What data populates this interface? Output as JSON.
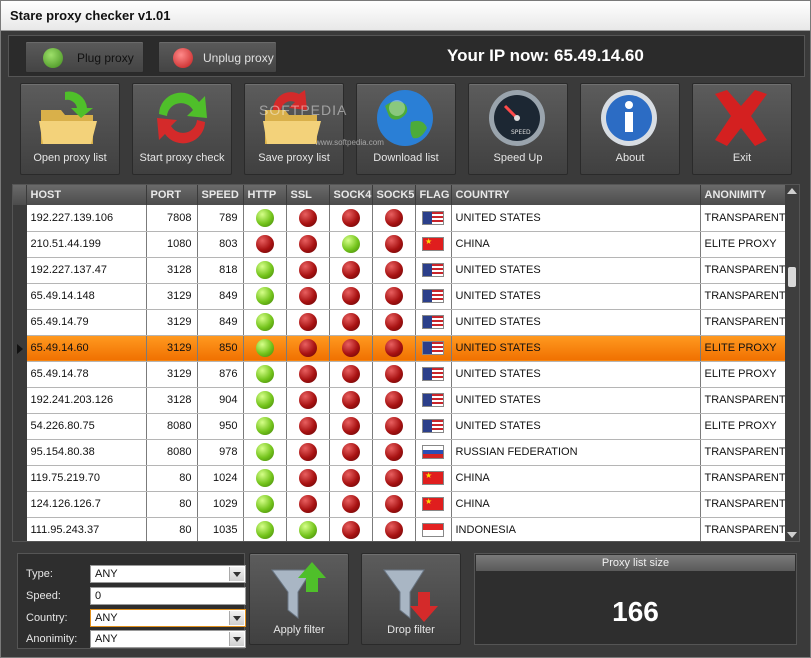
{
  "window": {
    "title": "Stare proxy checker v1.01"
  },
  "topbar": {
    "plug_label": "Plug proxy",
    "unplug_label": "Unplug proxy",
    "ip_text": "Your IP now: 65.49.14.60"
  },
  "toolbar": [
    {
      "label": "Open proxy list",
      "icon": "folder-open-icon"
    },
    {
      "label": "Start proxy check",
      "icon": "refresh-arrows-icon"
    },
    {
      "label": "Save proxy list",
      "icon": "folder-save-icon"
    },
    {
      "label": "Download list",
      "icon": "globe-icon"
    },
    {
      "label": "Speed Up",
      "icon": "speedometer-icon"
    },
    {
      "label": "About",
      "icon": "info-icon"
    },
    {
      "label": "Exit",
      "icon": "close-x-icon"
    }
  ],
  "watermark": {
    "main": "SOFTPEDIA",
    "sub": "www.softpedia.com"
  },
  "grid": {
    "columns": [
      "HOST",
      "PORT",
      "SPEED",
      "HTTP",
      "SSL",
      "SOCK4",
      "SOCK5",
      "FLAG",
      "COUNTRY",
      "ANONIMITY"
    ],
    "selected_row": 5,
    "rows": [
      {
        "host": "192.227.139.106",
        "port": "7808",
        "speed": "789",
        "http": "g",
        "ssl": "r",
        "sock4": "r",
        "sock5": "r",
        "flag": "us",
        "country": "UNITED STATES",
        "anonimity": "TRANSPARENT"
      },
      {
        "host": "210.51.44.199",
        "port": "1080",
        "speed": "803",
        "http": "r",
        "ssl": "r",
        "sock4": "g",
        "sock5": "r",
        "flag": "cn",
        "country": "CHINA",
        "anonimity": "ELITE PROXY"
      },
      {
        "host": "192.227.137.47",
        "port": "3128",
        "speed": "818",
        "http": "g",
        "ssl": "r",
        "sock4": "r",
        "sock5": "r",
        "flag": "us",
        "country": "UNITED STATES",
        "anonimity": "TRANSPARENT"
      },
      {
        "host": "65.49.14.148",
        "port": "3129",
        "speed": "849",
        "http": "g",
        "ssl": "r",
        "sock4": "r",
        "sock5": "r",
        "flag": "us",
        "country": "UNITED STATES",
        "anonimity": "TRANSPARENT"
      },
      {
        "host": "65.49.14.79",
        "port": "3129",
        "speed": "849",
        "http": "g",
        "ssl": "r",
        "sock4": "r",
        "sock5": "r",
        "flag": "us",
        "country": "UNITED STATES",
        "anonimity": "TRANSPARENT"
      },
      {
        "host": "65.49.14.60",
        "port": "3129",
        "speed": "850",
        "http": "g",
        "ssl": "r",
        "sock4": "r",
        "sock5": "r",
        "flag": "us",
        "country": "UNITED STATES",
        "anonimity": "ELITE PROXY"
      },
      {
        "host": "65.49.14.78",
        "port": "3129",
        "speed": "876",
        "http": "g",
        "ssl": "r",
        "sock4": "r",
        "sock5": "r",
        "flag": "us",
        "country": "UNITED STATES",
        "anonimity": "ELITE PROXY"
      },
      {
        "host": "192.241.203.126",
        "port": "3128",
        "speed": "904",
        "http": "g",
        "ssl": "r",
        "sock4": "r",
        "sock5": "r",
        "flag": "us",
        "country": "UNITED STATES",
        "anonimity": "TRANSPARENT"
      },
      {
        "host": "54.226.80.75",
        "port": "8080",
        "speed": "950",
        "http": "g",
        "ssl": "r",
        "sock4": "r",
        "sock5": "r",
        "flag": "us",
        "country": "UNITED STATES",
        "anonimity": "ELITE PROXY"
      },
      {
        "host": "95.154.80.38",
        "port": "8080",
        "speed": "978",
        "http": "g",
        "ssl": "r",
        "sock4": "r",
        "sock5": "r",
        "flag": "ru",
        "country": "RUSSIAN FEDERATION",
        "anonimity": "TRANSPARENT"
      },
      {
        "host": "119.75.219.70",
        "port": "80",
        "speed": "1024",
        "http": "g",
        "ssl": "r",
        "sock4": "r",
        "sock5": "r",
        "flag": "cn",
        "country": "CHINA",
        "anonimity": "TRANSPARENT"
      },
      {
        "host": "124.126.126.7",
        "port": "80",
        "speed": "1029",
        "http": "g",
        "ssl": "r",
        "sock4": "r",
        "sock5": "r",
        "flag": "cn",
        "country": "CHINA",
        "anonimity": "TRANSPARENT"
      },
      {
        "host": "111.95.243.37",
        "port": "80",
        "speed": "1035",
        "http": "g",
        "ssl": "g",
        "sock4": "r",
        "sock5": "r",
        "flag": "id",
        "country": "INDONESIA",
        "anonimity": "TRANSPARENT"
      }
    ]
  },
  "filters": {
    "type_label": "Type:",
    "type_value": "ANY",
    "speed_label": "Speed:",
    "speed_value": "0",
    "country_label": "Country:",
    "country_value": "ANY",
    "anonimity_label": "Anonimity:",
    "anonimity_value": "ANY",
    "apply_label": "Apply filter",
    "drop_label": "Drop filter"
  },
  "proxy_size": {
    "header": "Proxy list size",
    "value": "166"
  },
  "colors": {
    "selected_row": "#f58a10",
    "status_green": "#74c41c",
    "status_red": "#a81212"
  }
}
